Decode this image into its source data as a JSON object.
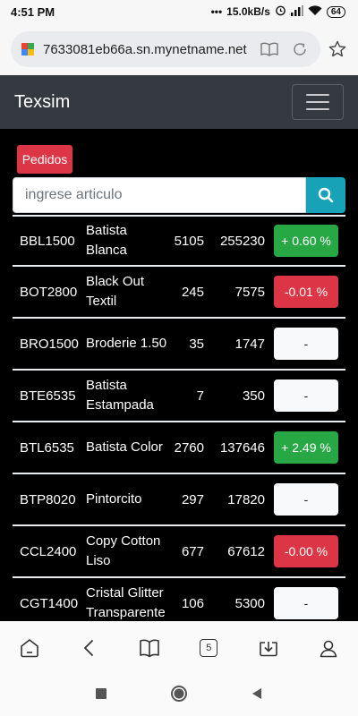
{
  "status_bar": {
    "time": "4:51 PM",
    "speed": "15.0kB/s",
    "battery": "64"
  },
  "browser": {
    "url": "7633081eb66a.sn.mynetname.net",
    "tab_count": "5"
  },
  "navbar": {
    "brand": "Texsim"
  },
  "pedidos_label": "Pedidos",
  "search": {
    "placeholder": "ingrese articulo"
  },
  "colors": {
    "green": "#28a745",
    "red": "#dc3545",
    "teal": "#17a2b8",
    "navbar": "#343a40"
  },
  "articles": [
    {
      "code": "BBL1500",
      "name": "Batista Blanca",
      "stock": "5105",
      "total": "255230",
      "variation": "+ 0.60 %",
      "status": "green"
    },
    {
      "code": "BOT2800",
      "name": "Black Out Textil",
      "stock": "245",
      "total": "7575",
      "variation": "-0.01 %",
      "status": "red"
    },
    {
      "code": "BRO1500",
      "name": "Broderie 1.50",
      "stock": "35",
      "total": "1747",
      "variation": "-",
      "status": "light"
    },
    {
      "code": "BTE6535",
      "name": "Batista Estampada",
      "stock": "7",
      "total": "350",
      "variation": "-",
      "status": "light"
    },
    {
      "code": "BTL6535",
      "name": "Batista Color",
      "stock": "2760",
      "total": "137646",
      "variation": "+ 2.49 %",
      "status": "green"
    },
    {
      "code": "BTP8020",
      "name": "Pintorcito",
      "stock": "297",
      "total": "17820",
      "variation": "-",
      "status": "light"
    },
    {
      "code": "CCL2400",
      "name": "Copy Cotton Liso",
      "stock": "677",
      "total": "67612",
      "variation": "-0.00 %",
      "status": "red"
    },
    {
      "code": "CGT1400",
      "name": "Cristal Glitter Transparente",
      "stock": "106",
      "total": "5300",
      "variation": "-",
      "status": "light"
    }
  ]
}
